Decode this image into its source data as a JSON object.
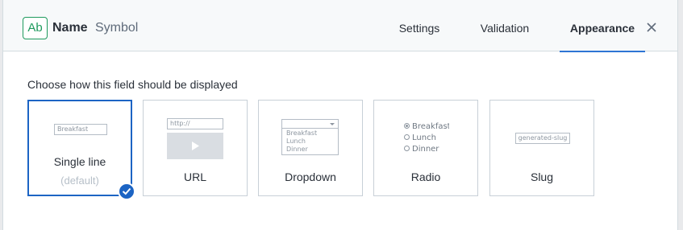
{
  "header": {
    "icon_text": "Ab",
    "field_name": "Name",
    "field_type": "Symbol",
    "tabs": [
      {
        "label": "Settings",
        "active": false
      },
      {
        "label": "Validation",
        "active": false
      },
      {
        "label": "Appearance",
        "active": true
      }
    ],
    "close_icon": "close-icon"
  },
  "main": {
    "prompt": "Choose how this field should be displayed",
    "options": [
      {
        "label": "Single line",
        "sublabel": "(default)",
        "selected": true,
        "preview_text": "Breakfast"
      },
      {
        "label": "URL",
        "selected": false,
        "preview_text": "http://"
      },
      {
        "label": "Dropdown",
        "selected": false,
        "preview_items": [
          "Breakfast",
          "Lunch",
          "Dinner"
        ]
      },
      {
        "label": "Radio",
        "selected": false,
        "preview_items": [
          "Breakfast",
          "Lunch",
          "Dinner"
        ]
      },
      {
        "label": "Slug",
        "selected": false,
        "preview_text": "generated-slug"
      }
    ]
  },
  "colors": {
    "accent": "#1c64c4",
    "field_icon": "#1e9a5d",
    "tab_underline": "#2e75d4"
  }
}
